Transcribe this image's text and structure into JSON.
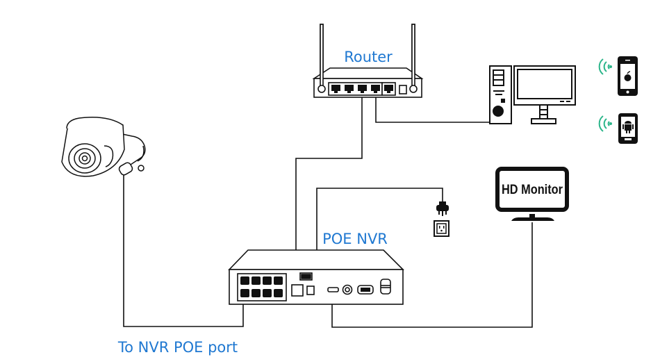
{
  "labels": {
    "router": "Router",
    "nvr": "POE NVR",
    "camera_port": "To NVR POE port",
    "monitor": "HD Monitor"
  },
  "devices": {
    "camera": "dome-camera-icon",
    "router": "router-icon",
    "pc": "desktop-computer-icon",
    "iphone": "apple-phone-icon",
    "android": "android-phone-icon",
    "monitor": "monitor-icon",
    "outlet": "power-outlet-icon",
    "plug": "power-plug-icon",
    "nvr": "nvr-icon"
  },
  "colors": {
    "label": "#1f78d1",
    "wifi": "#2bb58a",
    "line": "#111111"
  }
}
